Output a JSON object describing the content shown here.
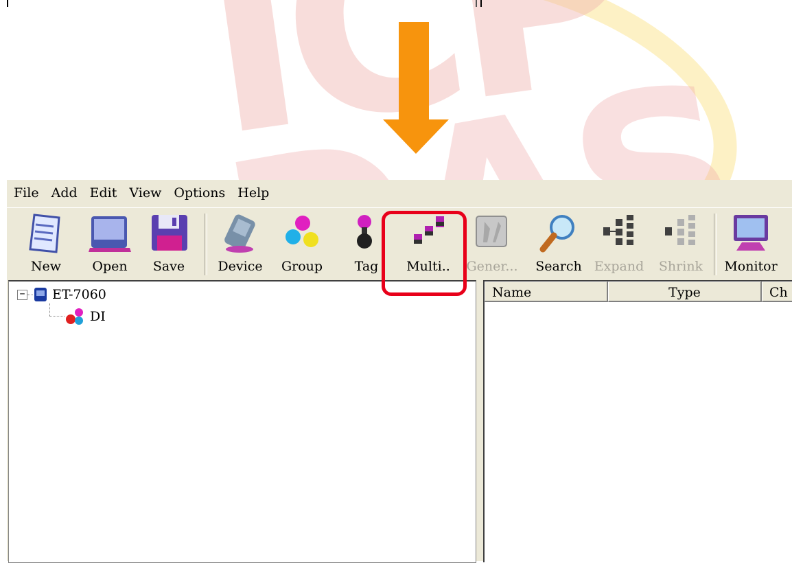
{
  "menu": [
    "File",
    "Add",
    "Edit",
    "View",
    "Options",
    "Help"
  ],
  "toolbar": {
    "new": "New",
    "open": "Open",
    "save": "Save",
    "device": "Device",
    "group": "Group",
    "tag": "Tag",
    "multi": "Multi..",
    "generate": "Gener...",
    "search": "Search",
    "expand": "Expand",
    "shrink": "Shrink",
    "monitor": "Monitor"
  },
  "tree": {
    "root_label": "ET-7060",
    "expander": "⊟",
    "child_label": "DI"
  },
  "list": {
    "columns": [
      "Name",
      "Type",
      "Ch"
    ]
  },
  "colors": {
    "arrow": "#f7940d",
    "highlight": "#e8001a",
    "window_bg": "#ece9d8"
  }
}
